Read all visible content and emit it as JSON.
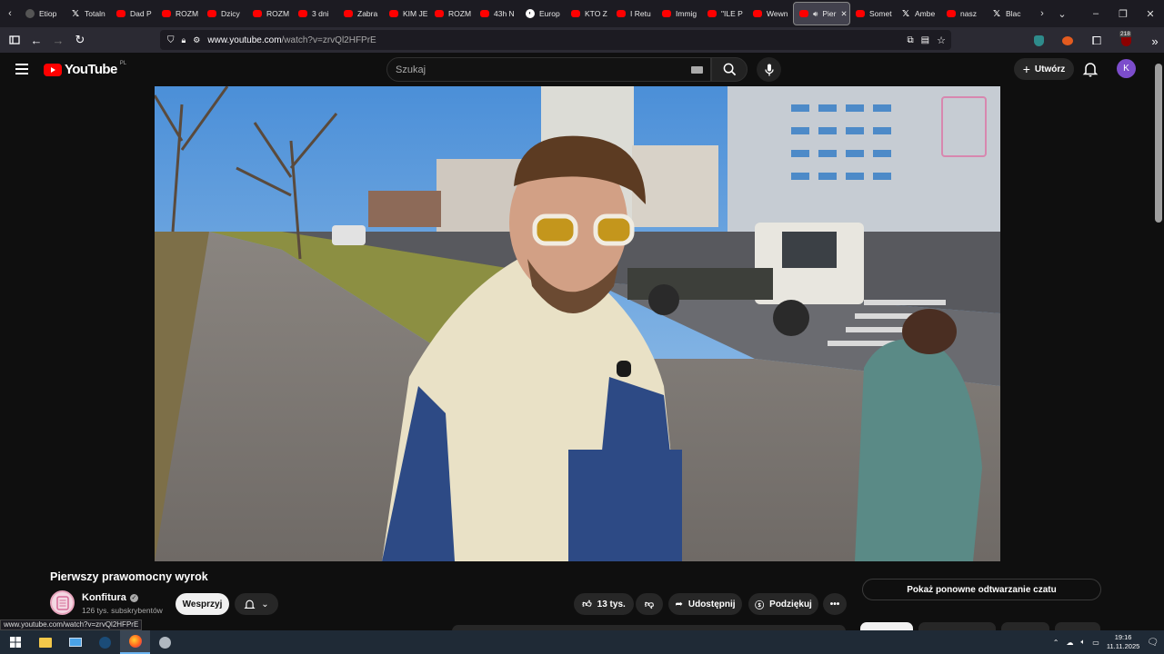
{
  "browser": {
    "tabs": [
      {
        "label": "Etiop",
        "icon": "page-icon"
      },
      {
        "label": "Totaln",
        "icon": "x-icon"
      },
      {
        "label": "Dad P",
        "icon": "youtube-icon"
      },
      {
        "label": "ROZM",
        "icon": "youtube-icon"
      },
      {
        "label": "Dzicy",
        "icon": "youtube-icon"
      },
      {
        "label": "ROZM",
        "icon": "youtube-icon"
      },
      {
        "label": "3 dni",
        "icon": "youtube-icon"
      },
      {
        "label": "Zabra",
        "icon": "youtube-icon"
      },
      {
        "label": "KIM JE",
        "icon": "youtube-icon"
      },
      {
        "label": "ROZM",
        "icon": "youtube-icon"
      },
      {
        "label": "43h N",
        "icon": "youtube-icon"
      },
      {
        "label": "Europ",
        "icon": "globe-icon"
      },
      {
        "label": "KTO Z",
        "icon": "youtube-icon"
      },
      {
        "label": "I Retu",
        "icon": "youtube-icon"
      },
      {
        "label": "Immig",
        "icon": "youtube-icon"
      },
      {
        "label": "\"ILE P",
        "icon": "youtube-icon"
      },
      {
        "label": "Wewn",
        "icon": "youtube-icon"
      },
      {
        "label": "Pier",
        "icon": "youtube-icon",
        "active": true
      },
      {
        "label": "Somet",
        "icon": "youtube-icon"
      },
      {
        "label": "Ambe",
        "icon": "x-icon"
      },
      {
        "label": "nasz",
        "icon": "youtube-icon"
      },
      {
        "label": "Blac",
        "icon": "x-icon"
      }
    ],
    "url_domain": "www.youtube.com",
    "url_path": "/watch?v=zrvQl2HFPrE",
    "extension_badge": "218",
    "status_url": "www.youtube.com/watch?v=zrvQl2HFPrE"
  },
  "youtube": {
    "logo_text": "YouTube",
    "country_code": "PL",
    "search_placeholder": "Szukaj",
    "create_label": "Utwórz",
    "avatar_letter": "K",
    "accent_color": "#ff0000"
  },
  "video": {
    "title": "Pierwszy prawomocny wyrok",
    "channel_name": "Konfitura",
    "subscribers": "126 tys. subskrybentów",
    "support_label": "Wesprzyj",
    "likes": "13 tys.",
    "share_label": "Udostępnij",
    "thanks_label": "Podziękuj",
    "chat_replay_label": "Pokaż ponowne odtwarzanie czatu"
  },
  "taskbar": {
    "time": "19:16",
    "date": "11.11.2025"
  }
}
